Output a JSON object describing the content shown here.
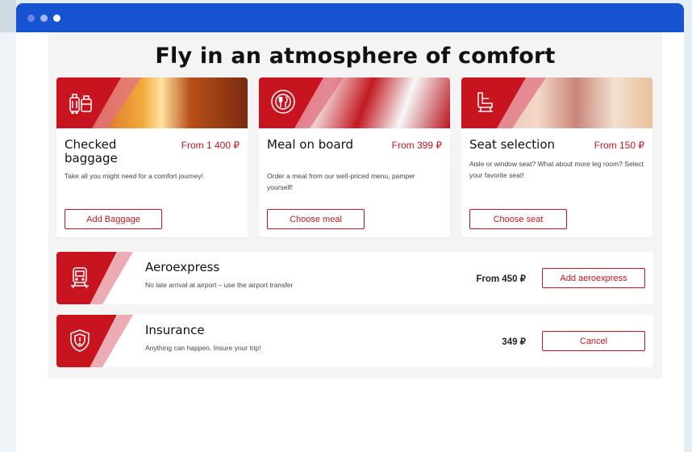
{
  "headline": "Fly in an atmosphere of comfort",
  "cards": [
    {
      "title": "Checked baggage",
      "price": "From 1 400 ₽",
      "description": "Take all you might need for a comfort journey!",
      "button": "Add Baggage",
      "icon": "luggage-icon"
    },
    {
      "title": "Meal on board",
      "price": "From 399 ₽",
      "description": "Order a meal from our well-priced menu, pamper yourself!",
      "button": "Choose meal",
      "icon": "meal-icon"
    },
    {
      "title": "Seat selection",
      "price": "From 150 ₽",
      "description": "Aisle or window seat? What about more leg room? Select your favorite seat!",
      "button": "Choose seat",
      "icon": "seat-icon"
    }
  ],
  "rows": [
    {
      "title": "Aeroexpress",
      "description": "No late arrival at airport – use the airport transfer",
      "price": "From 450 ₽",
      "button": "Add aeroexpress",
      "icon": "train-icon"
    },
    {
      "title": "Insurance",
      "description": "Anything can happen. Insure your trip!",
      "price": "349 ₽",
      "button": "Cancel",
      "icon": "shield-icon"
    }
  ],
  "colors": {
    "accent": "#c8141e",
    "titlebar": "#1553d1",
    "background": "#f4f4f4"
  }
}
